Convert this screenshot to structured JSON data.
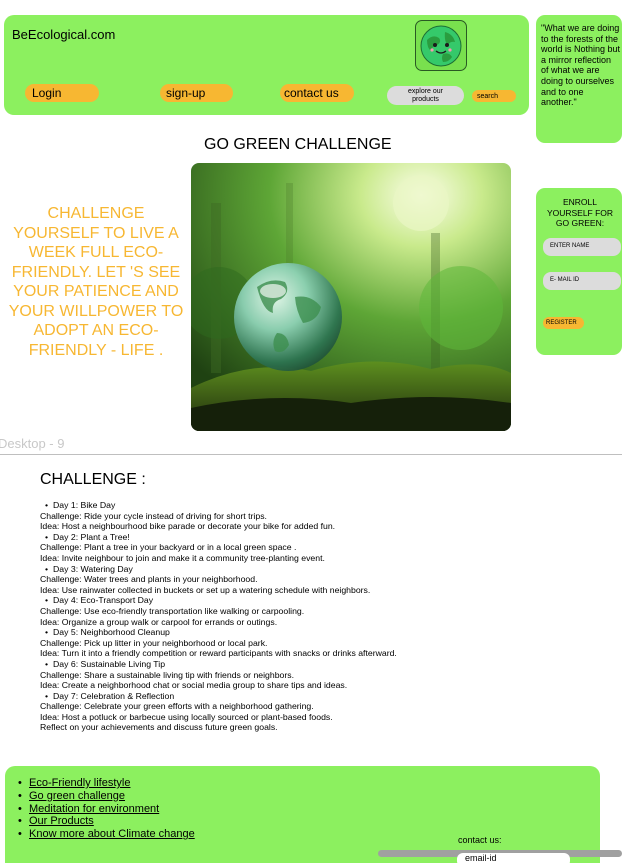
{
  "header": {
    "site_name": "BeEcological.com",
    "login": "Login",
    "signup": "sign-up",
    "contact": "contact us",
    "explore": "explore our products",
    "search": "search"
  },
  "quote": "\"What we are doing to the forests of the world is Nothing but a mirror reflection of what we are doing to ourselves and to one another.\"",
  "main": {
    "title": "GO GREEN CHALLENGE",
    "challenge_text": "CHALLENGE YOURSELF TO LIVE A WEEK FULL ECO-FRIENDLY. LET 'S SEE YOUR PATIENCE AND YOUR WILLPOWER TO ADOPT AN ECO-FRIENDLY - LIFE ."
  },
  "enroll": {
    "title": "ENROLL YOURSELF FOR GO GREEN:",
    "name_placeholder": "ENTER NAME",
    "email_placeholder": "E- MAIL ID",
    "register": "REGISTER"
  },
  "frame_label": "Desktop - 9",
  "challenge_section": {
    "title": "CHALLENGE :",
    "days": [
      {
        "title": "Day 1: Bike Day",
        "challenge": "Challenge: Ride your cycle instead of driving for short trips.",
        "idea": "Idea: Host a neighbourhood bike parade or decorate your bike for added fun."
      },
      {
        "title": "Day 2: Plant a Tree!",
        "challenge": "Challenge: Plant a tree in your backyard or in a local green space .",
        "idea": "Idea: Invite neighbour to join and make it a community tree-planting event."
      },
      {
        "title": "Day 3: Watering Day",
        "challenge": "Challenge: Water trees and plants in your neighborhood.",
        "idea": "Idea: Use rainwater collected in buckets or set up a watering schedule with neighbors."
      },
      {
        "title": "Day 4: Eco-Transport Day",
        "challenge": "Challenge: Use eco-friendly transportation like walking or carpooling.",
        "idea": "Idea: Organize a group walk or carpool for errands or outings."
      },
      {
        "title": "Day 5: Neighborhood Cleanup",
        "challenge": "Challenge: Pick up litter in your neighborhood or local park.",
        "idea": "Idea: Turn it into a friendly competition or reward participants with snacks or drinks afterward."
      },
      {
        "title": "Day 6: Sustainable Living Tip",
        "challenge": "Challenge: Share a sustainable living tip with friends or neighbors.",
        "idea": "Idea: Create a neighborhood chat or social media group to share tips and ideas."
      },
      {
        "title": "Day 7: Celebration & Reflection",
        "challenge": "Challenge: Celebrate your green efforts with a neighborhood gathering.",
        "idea": "Idea: Host a potluck or barbecue using locally sourced or plant-based foods."
      }
    ],
    "closing": "Reflect on your achievements and discuss future green goals."
  },
  "footer": {
    "links": [
      "Eco-Friendly lifestyle",
      "Go green challenge",
      "Meditation for environment",
      "Our Products",
      "Know more about Climate change"
    ],
    "contact_label": "contact us:",
    "email_placeholder": "email-id"
  },
  "colors": {
    "green": "#8cf05f",
    "orange": "#f7b732",
    "gray": "#dcdcdc"
  }
}
